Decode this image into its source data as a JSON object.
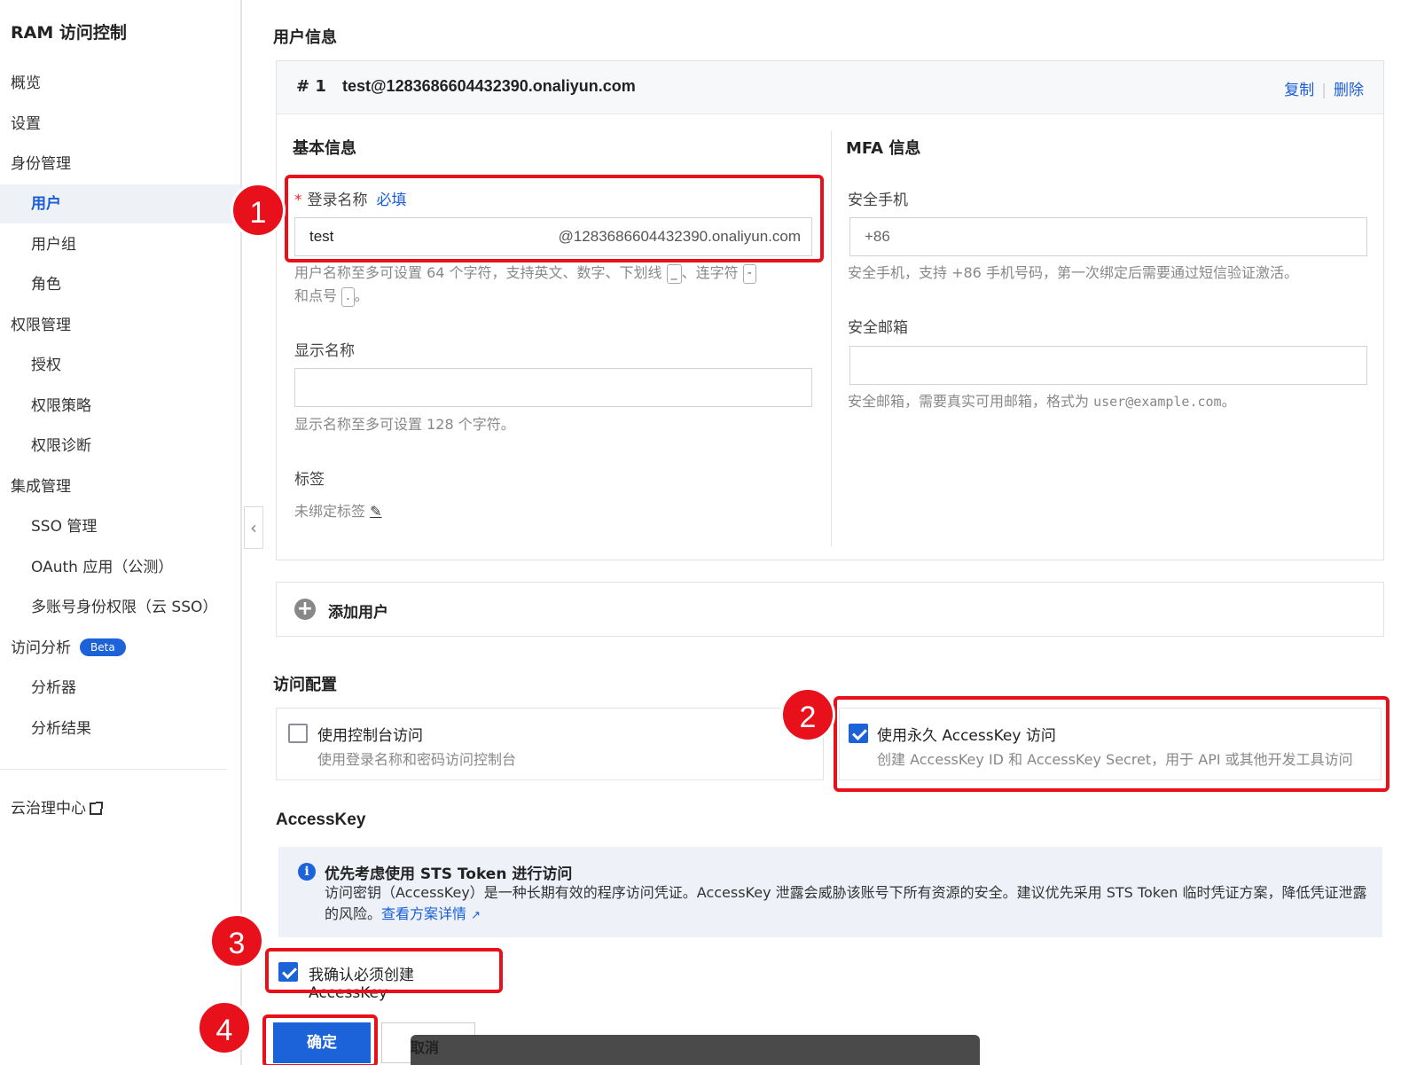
{
  "sidebar": {
    "title": "RAM 访问控制",
    "items": [
      {
        "label": "概览"
      },
      {
        "label": "设置"
      },
      {
        "label": "身份管理"
      },
      {
        "label": "用户"
      },
      {
        "label": "用户组"
      },
      {
        "label": "角色"
      },
      {
        "label": "权限管理"
      },
      {
        "label": "授权"
      },
      {
        "label": "权限策略"
      },
      {
        "label": "权限诊断"
      },
      {
        "label": "集成管理"
      },
      {
        "label": "SSO 管理"
      },
      {
        "label": "OAuth 应用（公测）"
      },
      {
        "label": "多账号身份权限（云 SSO）"
      },
      {
        "label": "访问分析",
        "badge": "Beta"
      },
      {
        "label": "分析器"
      },
      {
        "label": "分析结果"
      }
    ],
    "footer_link": "云治理中心"
  },
  "main": {
    "user_info_title": "用户信息",
    "user_card": {
      "number": "# 1",
      "email": "test@1283686604432390.onaliyun.com",
      "copy_label": "复制",
      "delete_label": "删除",
      "basic_info_title": "基本信息",
      "mfa_title": "MFA 信息",
      "login_name_label": "登录名称",
      "required_label": "必填",
      "login_name_value": "test",
      "login_name_suffix": "@1283686604432390.onaliyun.com",
      "login_help_1": "用户名称至多可设置 64 个字符，支持英文、数字、下划线",
      "login_help_kbd1": "_",
      "login_help_2": "、连字符",
      "login_help_kbd2": "-",
      "login_help_3": "和点号",
      "login_help_kbd3": ".",
      "login_help_4": "。",
      "display_name_label": "显示名称",
      "display_name_value": "",
      "display_name_help": "显示名称至多可设置 128 个字符。",
      "tags_label": "标签",
      "tags_value": "未绑定标签",
      "phone_label": "安全手机",
      "phone_placeholder": "+86",
      "phone_help": "安全手机，支持 +86 手机号码，第一次绑定后需要通过短信验证激活。",
      "email_label": "安全邮箱",
      "email_value": "",
      "email_help_1": "安全邮箱，需要真实可用邮箱，格式为 ",
      "email_help_code": "user@example.com",
      "email_help_2": "。"
    },
    "add_user_label": "添加用户",
    "access_config_title": "访问配置",
    "console_access": {
      "title": "使用控制台访问",
      "desc": "使用登录名称和密码访问控制台",
      "checked": false
    },
    "accesskey_access": {
      "title": "使用永久 AccessKey 访问",
      "desc": "创建 AccessKey ID 和 AccessKey Secret，用于 API 或其他开发工具访问",
      "checked": true
    },
    "accesskey_title": "AccessKey",
    "alert": {
      "title": "优先考虑使用 STS Token 进行访问",
      "body_1": "访问密钥（AccessKey）是一种长期有效的程序访问凭证。AccessKey 泄露会威胁该账号下所有资源的安全。建议优先采用 STS Token 临时凭证方案，降低凭证泄露的风险。",
      "link": "查看方案详情"
    },
    "confirm_checkbox_label": "我确认必须创建 AccessKey",
    "confirm_checked": true,
    "confirm_button": "确定",
    "cancel_button": "取消",
    "tooltip_text": "取消"
  },
  "annotations": [
    "1",
    "2",
    "3",
    "4"
  ],
  "colors": {
    "accent": "#1c62d8",
    "annotation_red": "#e8101a",
    "active_nav_bg": "#eef1f6"
  }
}
